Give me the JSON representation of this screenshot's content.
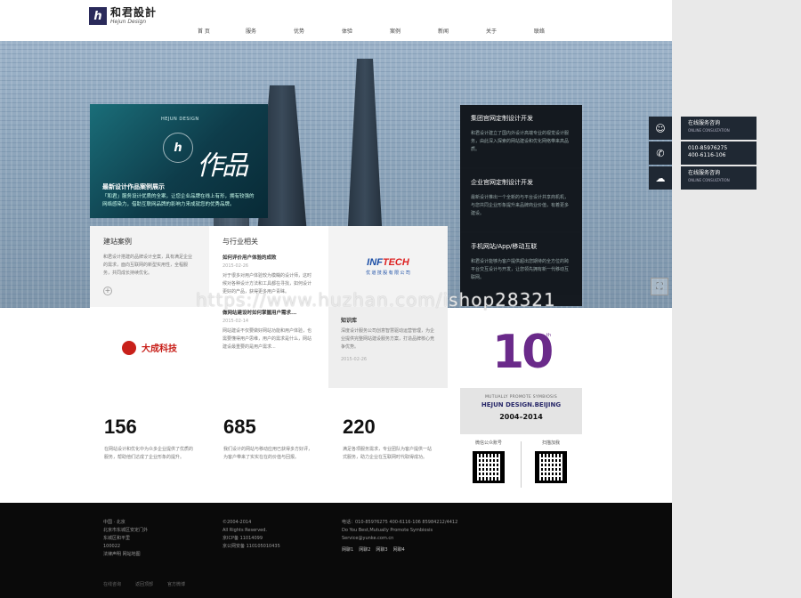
{
  "header": {
    "logo_mark": "h",
    "logo_cn": "和君設計",
    "logo_en": "Hejun Design",
    "nav": [
      "首 页",
      "服务",
      "优势",
      "体验",
      "案例",
      "新闻",
      "关于",
      "联络"
    ]
  },
  "works": {
    "tag": "HEJUN DESIGN",
    "big": "作品",
    "circle": "h",
    "title": "最新设计作品案例展示",
    "desc": "「和君」服务设计优质的全案，让您企业品牌在线上有形，拥有较强的网络感染力，借助互联网品牌的影响力来成就您的优秀品牌。"
  },
  "news_column": [
    {
      "title": "集团官网定制设计开发",
      "desc": "和君设计建立了国内外设计高端专业的视觉设计服务，由此深入探索的网站建设和优化网络带来高品质。"
    },
    {
      "title": "企业官网定制设计开发",
      "desc": "最新设计推出一个全新的与平台设计共享商机机，与您共同企业形象提升来品牌商业价值，有着更多建设。"
    },
    {
      "title": "手机网站/App/移动互联",
      "desc": "和君设计能够为客户提供超出您期待的全方位的跨平台交互设计与开发，让您领先拥有新一代移动互联网。"
    }
  ],
  "service": {
    "online1": "在线服务咨询",
    "online1_en": "ONLINE CONSULTATION",
    "phone1": "010-85976275",
    "phone2": "400-6116-106",
    "online2": "在线服务咨询",
    "online2_en": "ONLINE CONSULTATION"
  },
  "grid": {
    "case_title": "建站案例",
    "case_desc": "和君设计搭建的品牌设计全案，具有满足企业的需求，面向互联网的新型实用性，全程服务，共同成长持续优化。",
    "case_plus": "+",
    "news_title": "与行业相关",
    "news1_title": "如何评价用户体验的成败",
    "news1_date": "2015-02-26",
    "news1_desc": "对于很多对用户体验较为模糊的设计师，这时候对各种设计方法和工具都在寻找，如何设计更好的产品，获得更多用户青睐。",
    "news2_title": "做网站建设时如何掌握用户需求...",
    "news2_date": "2015-02-14",
    "news2_desc": "网站建设不仅要做好网站功能和用户体验，也需要懂得用户思维，用户的需求是什么，网站建设最重要的是用户需求...",
    "info_logo_main": "INF",
    "info_logo_accent": "TECH",
    "info_logo_sub": "优 道 技 股 有 限 公 司",
    "dacheng": "大成科技",
    "know_title": "知识库",
    "know_desc": "深度设计服务公司创意智慧驱动运营管理，为企业提供完整网站建设服务方案，打造品牌核心竞争优势。",
    "know_date": "2015-02-26"
  },
  "anniv": {
    "num": "10",
    "th": "th",
    "small": "MUTUALLY PROMOTE SYMBIOSIS",
    "name": "HEJUN DESIGN.BEIJING",
    "years": "2004–2014"
  },
  "qr": {
    "label1": "微信公众账号",
    "label2": "扫描加我"
  },
  "stats": [
    {
      "num": "156",
      "desc": "在网站设计和优化中为众多企业提供了优质的服务，帮助他们达成了企业形象的提升。"
    },
    {
      "num": "685",
      "desc": "我们设计的网站与移动应用已获得多方好评，为客户带来了实实在在的价值与回报。"
    },
    {
      "num": "220",
      "desc": "满足各项服务需求，专业团队为客户提供一站式服务，助力企业在互联网时代取得成功。"
    }
  ],
  "footer": {
    "col1": [
      "中国 · 北京",
      "北京市东城区安定门外",
      "东城区和平里",
      "100022",
      "法律声明    网站地图"
    ],
    "col2": [
      "©2004-2014",
      "All Rights Reserved.",
      "京ICP备 11014099",
      "京公网安备 110105010435"
    ],
    "col3": [
      "电话：010-85976275    400-6116-106    85984212/4412",
      "Do You Best,Mutually Promote Symbiosis",
      "Service@yunke.com.cn"
    ],
    "chats": [
      "网聊1",
      "网聊2",
      "网聊3",
      "网聊4"
    ],
    "bottom": [
      "在线咨询",
      "返回顶部",
      "官方微博"
    ]
  },
  "watermark": "https://www.huzhan.com/ishop28321"
}
